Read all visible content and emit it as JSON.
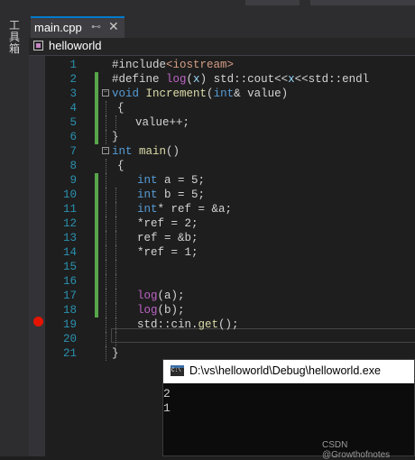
{
  "toolbox": {
    "label": "工具箱"
  },
  "tab": {
    "title": "main.cpp",
    "pin_icon": "pin-icon",
    "close_icon": "close-icon"
  },
  "navbar": {
    "project": "helloworld",
    "project_icon": "cpp-project-icon"
  },
  "editor": {
    "breakpoint_line": 19,
    "lines": [
      {
        "n": "1",
        "text": "#include<iostream>"
      },
      {
        "n": "2",
        "text": "#define log(x) std::cout<<x<<std::endl"
      },
      {
        "n": "3",
        "text": "void Increment(int& value)"
      },
      {
        "n": "4",
        "text": "{"
      },
      {
        "n": "5",
        "text": "value++;"
      },
      {
        "n": "6",
        "text": "}"
      },
      {
        "n": "7",
        "text": "int main()"
      },
      {
        "n": "8",
        "text": "{"
      },
      {
        "n": "9",
        "text": "int a = 5;"
      },
      {
        "n": "10",
        "text": "int b = 5;"
      },
      {
        "n": "11",
        "text": "int* ref = &a;"
      },
      {
        "n": "12",
        "text": "*ref = 2;"
      },
      {
        "n": "13",
        "text": "ref = &b;"
      },
      {
        "n": "14",
        "text": "*ref = 1;"
      },
      {
        "n": "15",
        "text": ""
      },
      {
        "n": "16",
        "text": ""
      },
      {
        "n": "17",
        "text": "log(a);"
      },
      {
        "n": "18",
        "text": "log(b);"
      },
      {
        "n": "19",
        "text": "std::cin.get();"
      },
      {
        "n": "20",
        "text": ""
      },
      {
        "n": "21",
        "text": "}"
      }
    ]
  },
  "console": {
    "title": "D:\\vs\\helloworld\\Debug\\helloworld.exe",
    "output": [
      "2",
      "1"
    ]
  },
  "watermark": "CSDN @Growthofnotes",
  "colors": {
    "keyword": "#569cd6",
    "function": "#dcdcaa",
    "macro": "#bd63c5",
    "string": "#d69d85",
    "param": "#9cdcfe",
    "plain": "#d4d4d4",
    "line_number": "#2b91af",
    "change_bar": "#57a64a",
    "breakpoint": "#e51400"
  }
}
